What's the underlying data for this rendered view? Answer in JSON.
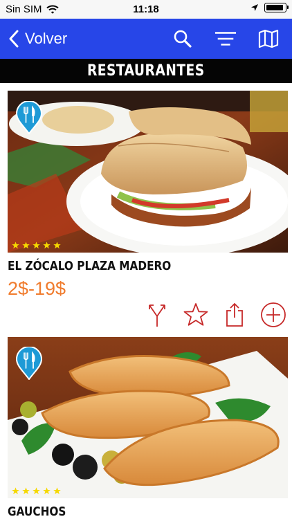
{
  "status_bar": {
    "carrier": "Sin SIM",
    "time": "11:18"
  },
  "nav": {
    "back_label": "Volver",
    "icons": [
      "search-icon",
      "filter-sort-icon",
      "map-icon"
    ],
    "bar_color": "#2746e8"
  },
  "section": {
    "title": "RESTAURANTES"
  },
  "restaurants": [
    {
      "name": "EL ZÓCALO PLAZA MADERO",
      "price": "2$-19$",
      "rating_stars": 5,
      "category_icon": "fork-knife-icon",
      "actions": [
        "directions-icon",
        "favorite-star-icon",
        "share-icon",
        "add-icon"
      ]
    },
    {
      "name": "GAUCHOS",
      "rating_stars": 5,
      "category_icon": "fork-knife-icon"
    }
  ],
  "colors": {
    "accent": "#f07c2e",
    "action_icon": "#c62828",
    "pin": "#1e9ad6",
    "star": "#f5d800"
  }
}
